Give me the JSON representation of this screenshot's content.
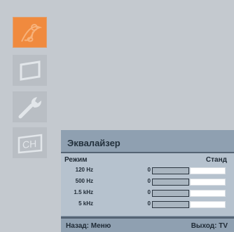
{
  "sidebar": {
    "items": [
      {
        "icon": "music-note-icon",
        "active": true
      },
      {
        "icon": "tv-screen-icon",
        "active": false
      },
      {
        "icon": "wrench-icon",
        "active": false
      },
      {
        "icon": "channel-icon",
        "active": false
      }
    ]
  },
  "equalizer": {
    "title": "Эквалайзер",
    "mode_label": "Режим",
    "mode_value": "Станд",
    "bands": [
      {
        "freq": "120 Hz",
        "value": "0",
        "level": 0
      },
      {
        "freq": "500 Hz",
        "value": "0",
        "level": 0
      },
      {
        "freq": "1.5 kHz",
        "value": "0",
        "level": 0
      },
      {
        "freq": "5 kHz",
        "value": "0",
        "level": 0
      }
    ],
    "footer": {
      "back": "Назад: Меню",
      "exit": "Выход: TV"
    }
  },
  "colors": {
    "background": "#c4c9cf",
    "active_icon": "#f08a3e",
    "panel_header": "#8fa0b1",
    "panel_body": "#b6c2ce"
  }
}
